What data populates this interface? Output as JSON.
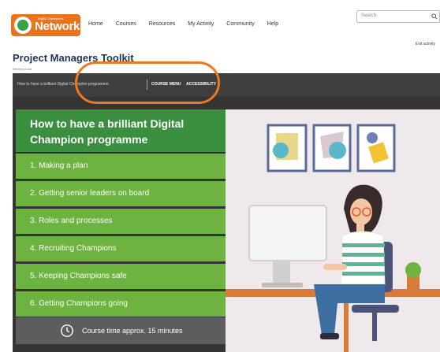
{
  "header": {
    "logo": {
      "tagline": "Digital Champions",
      "text": "Network"
    },
    "nav": [
      "Home",
      "Courses",
      "Resources",
      "My Activity",
      "Community",
      "Help"
    ],
    "search": {
      "placeholder": "Search"
    },
    "exit_link": "Exit activity"
  },
  "page": {
    "title": "Project Managers Toolkit",
    "subtitle": "Review mode"
  },
  "course_bar": {
    "title": "How to have a brilliant Digital Champion programme",
    "menu_label": "COURSE MENU",
    "accessibility_label": "ACCESSIBILITY"
  },
  "course": {
    "heading": "How to have a brilliant Digital Champion programme",
    "items": [
      "1. Making a plan",
      "2. Getting senior leaders on board",
      "3. Roles and processes",
      "4. Recruiting Champions",
      "5. Keeping Champions safe",
      "6. Getting Champions going"
    ],
    "time": "Course time approx. 15 minutes"
  },
  "colors": {
    "brand_orange": "#e8741e",
    "menu_green": "#6cb33f",
    "header_green": "#3a8f3e",
    "bar_dark": "#3e3e3e",
    "highlight": "#ee7a1f"
  }
}
